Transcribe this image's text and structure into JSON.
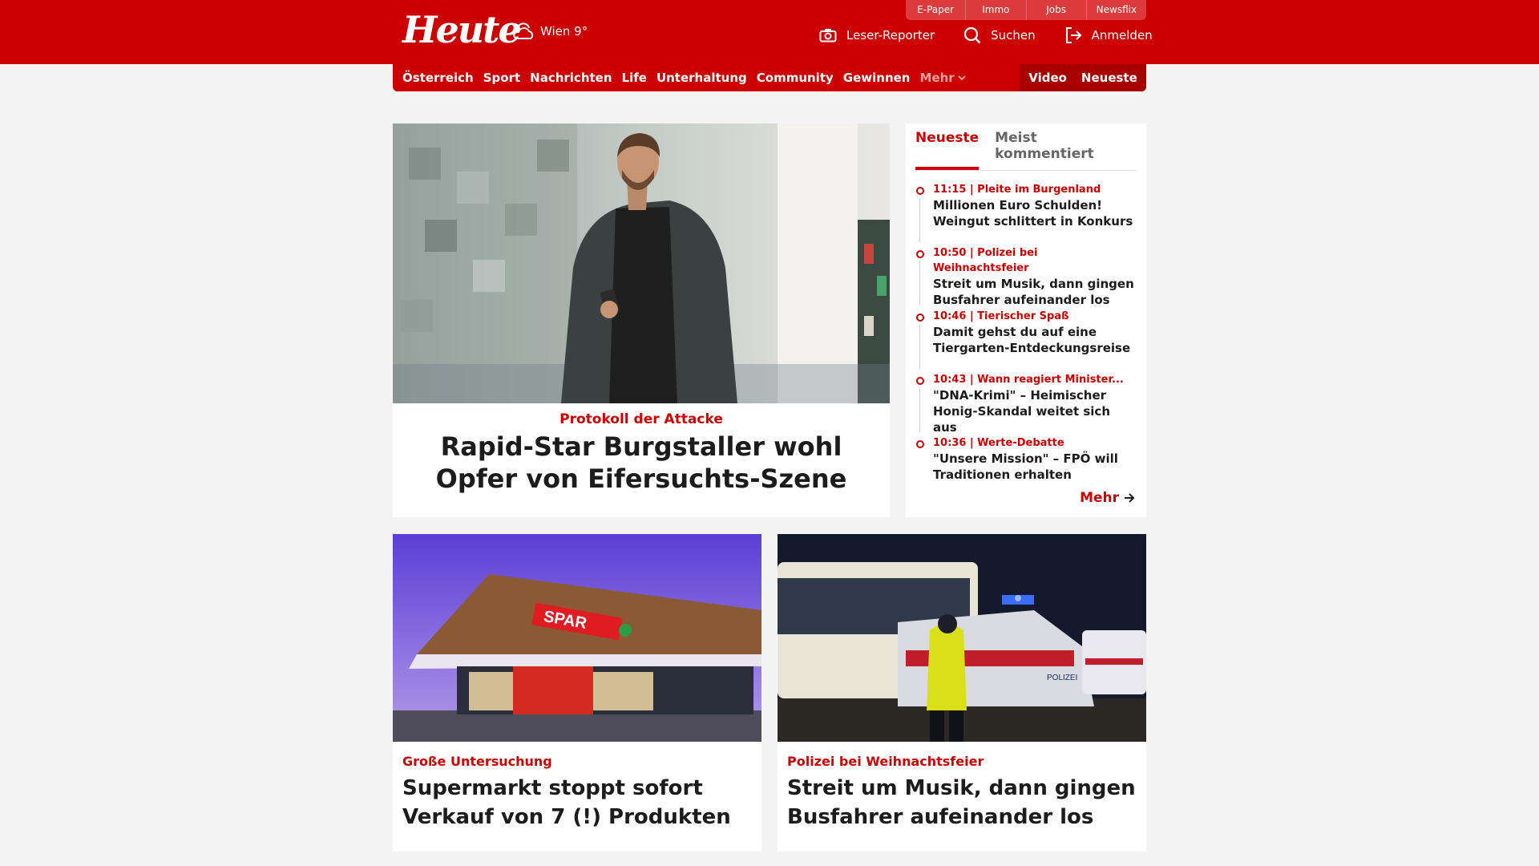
{
  "header": {
    "logo": "Heute",
    "weather": "Wien 9°",
    "top_links": [
      "E-Paper",
      "Immo",
      "Jobs",
      "Newsflix"
    ],
    "leser_reporter": "Leser-Reporter",
    "search": "Suchen",
    "login": "Anmelden"
  },
  "nav": {
    "items": [
      "Österreich",
      "Sport",
      "Nachrichten",
      "Life",
      "Unterhaltung",
      "Community",
      "Gewinnen"
    ],
    "more": "Mehr",
    "video": "Video",
    "neueste": "Neueste"
  },
  "hero": {
    "kicker": "Protokoll der Attacke",
    "title": "Rapid-Star Burgstaller wohl Opfer von Eifersuchts-Szene"
  },
  "sidebar": {
    "tabs": [
      "Neueste",
      "Meist kommentiert"
    ],
    "items": [
      {
        "meta": "11:15 | Pleite im Burgenland",
        "headline": "Millionen Euro Schulden! Weingut schlittert in Konkurs"
      },
      {
        "meta": "10:50 | Polizei bei Weihnachtsfeier",
        "headline": "Streit um Musik, dann gingen Busfahrer aufeinander los"
      },
      {
        "meta": "10:46 | Tierischer Spaß",
        "headline": "Damit gehst du auf eine Tiergarten-Entdeckungsreise"
      },
      {
        "meta": "10:43 | Wann reagiert Minister...",
        "headline": "\"DNA-Krimi\" – Heimischer Honig-Skandal weitet sich aus"
      },
      {
        "meta": "10:36 | Werte-Debatte",
        "headline": "\"Unsere Mission\" – FPÖ will Traditionen erhalten"
      }
    ],
    "more": "Mehr"
  },
  "cards": [
    {
      "kicker": "Große Untersuchung",
      "title": "Supermarkt stoppt sofort Verkauf von 7 (!) Produkten",
      "image_text": "SPAR"
    },
    {
      "kicker": "Polizei bei Weihnachtsfeier",
      "title": "Streit um Musik, dann gingen Busfahrer aufeinander los",
      "image_text": "POLIZEI"
    }
  ],
  "colors": {
    "brand": "#cc0000",
    "brand_dark": "#a80000",
    "background": "#f4f4f4"
  }
}
